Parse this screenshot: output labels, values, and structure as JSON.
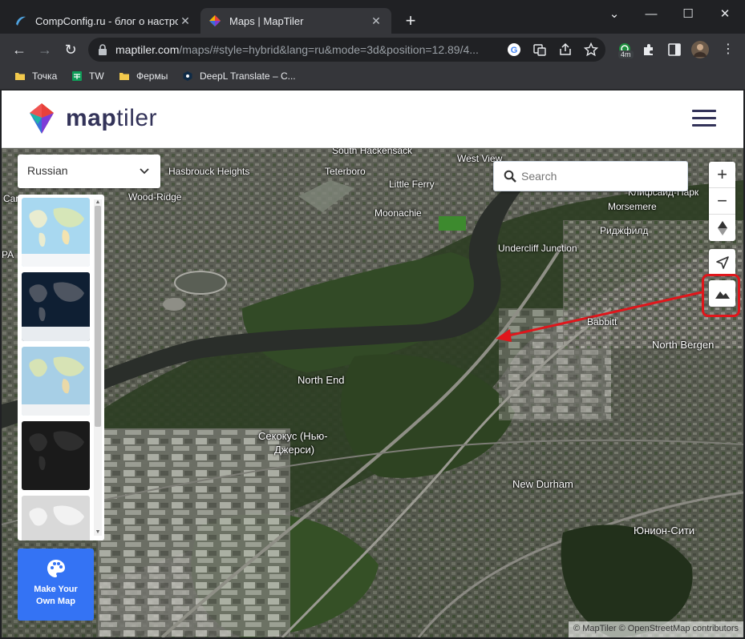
{
  "browser": {
    "tabs": [
      {
        "title": "CompConfig.ru - блог о настрой",
        "active": false
      },
      {
        "title": "Maps | MapTiler",
        "active": true
      }
    ],
    "window_controls": {
      "minimize": "—",
      "maximize": "☐",
      "close": "✕",
      "tab_search": "⌄"
    },
    "new_tab_label": "+",
    "url_host": "maptiler.com",
    "url_path": "/maps/#style=hybrid&lang=ru&mode=3d&position=12.89/4...",
    "extension_badge": "4m",
    "bookmarks": [
      {
        "label": "Точка",
        "icon": "folder-icon"
      },
      {
        "label": "TW",
        "icon": "sheets-icon"
      },
      {
        "label": "Фермы",
        "icon": "folder-icon"
      },
      {
        "label": "DeepL Translate – C...",
        "icon": "deepl-icon"
      }
    ]
  },
  "site": {
    "logo_word_bold": "map",
    "logo_word_light": "tiler"
  },
  "map": {
    "language_select": {
      "value": "Russian"
    },
    "search": {
      "placeholder": "Search"
    },
    "controls": {
      "zoom_in": "+",
      "zoom_out": "−"
    },
    "make_map": {
      "line1": "Make Your",
      "line2": "Own Map"
    },
    "attribution": "© MapTiler © OpenStreetMap contributors",
    "labels": [
      "South Hackensack",
      "West View",
      "Hasbrouck Heights",
      "Teterboro",
      "Little Ferry",
      "Carlton Hill",
      "Wood-Ridge",
      "Moonachie",
      "Клифсайд-Парк",
      "Morsemere",
      "Риджфилд",
      "PA",
      "Undercliff Junction",
      "Babbitt",
      "North Bergen",
      "North End",
      "Секокус (Нью-",
      "Джерси)",
      "New Durham",
      "Юнион-Сити"
    ]
  }
}
